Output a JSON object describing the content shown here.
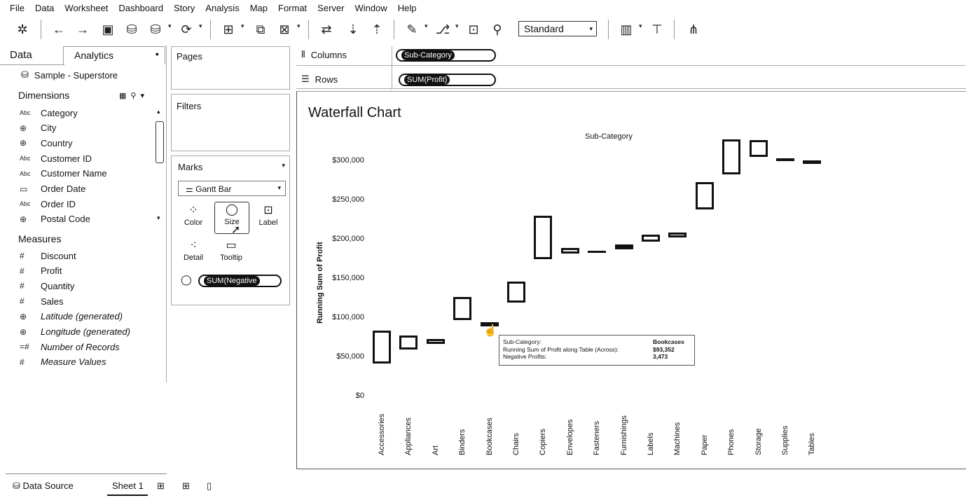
{
  "menu": [
    "File",
    "Data",
    "Worksheet",
    "Dashboard",
    "Story",
    "Analysis",
    "Map",
    "Format",
    "Server",
    "Window",
    "Help"
  ],
  "toolbar": {
    "fit": "Standard",
    "icons": [
      "tableau-logo-icon",
      "undo-icon",
      "redo-icon",
      "save-icon",
      "new-datasource-icon",
      "pause-icon",
      "refresh-icon",
      "new-worksheet-icon",
      "duplicate-icon",
      "clear-sheet-icon",
      "swap-icon",
      "sort-asc-icon",
      "sort-desc-icon",
      "highlight-icon",
      "group-icon",
      "labels-icon",
      "pin-icon",
      "show-cards-icon",
      "presentation-icon",
      "share-icon"
    ]
  },
  "data_pane": {
    "tab_data": "Data",
    "tab_analytics": "Analytics",
    "datasource": "Sample - Superstore",
    "dimensions_header": "Dimensions",
    "measures_header": "Measures",
    "dimensions": [
      {
        "type": "Abc",
        "label": "Category"
      },
      {
        "type": "globe",
        "label": "City"
      },
      {
        "type": "globe",
        "label": "Country"
      },
      {
        "type": "Abc",
        "label": "Customer ID"
      },
      {
        "type": "Abc",
        "label": "Customer Name"
      },
      {
        "type": "date",
        "label": "Order Date"
      },
      {
        "type": "Abc",
        "label": "Order ID"
      },
      {
        "type": "globe",
        "label": "Postal Code"
      }
    ],
    "measures": [
      {
        "type": "#",
        "label": "Discount"
      },
      {
        "type": "#",
        "label": "Profit"
      },
      {
        "type": "#",
        "label": "Quantity"
      },
      {
        "type": "#",
        "label": "Sales"
      },
      {
        "type": "globe",
        "label": "Latitude (generated)",
        "italic": true
      },
      {
        "type": "globe",
        "label": "Longitude (generated)",
        "italic": true
      },
      {
        "type": "=#",
        "label": "Number of Records",
        "italic": true
      },
      {
        "type": "#",
        "label": "Measure Values",
        "italic": true
      }
    ]
  },
  "cards": {
    "pages": "Pages",
    "filters": "Filters",
    "marks": "Marks",
    "mark_type": "Gantt Bar",
    "mark_buttons": [
      "Color",
      "Size",
      "Label",
      "Detail",
      "Tooltip"
    ],
    "size_pill": "SUM(Negative"
  },
  "shelves": {
    "columns_label": "Columns",
    "columns_pill": "Sub-Category",
    "rows_label": "Rows",
    "rows_pill": "SUM(Profit)"
  },
  "view": {
    "title": "Waterfall Chart"
  },
  "chart_data": {
    "type": "bar",
    "title": "Waterfall Chart",
    "xlabel": "Sub-Category",
    "ylabel": "Running Sum of Profit",
    "y_ticks": [
      "$0",
      "$50,000",
      "$100,000",
      "$150,000",
      "$200,000",
      "$250,000",
      "$300,000"
    ],
    "ylim": [
      0,
      300000
    ],
    "categories": [
      "Accessories",
      "Appliances",
      "Art",
      "Binders",
      "Bookcases",
      "Chairs",
      "Copiers",
      "Envelopes",
      "Fasteners",
      "Furnishings",
      "Labels",
      "Machines",
      "Paper",
      "Phones",
      "Storage",
      "Supplies",
      "Tables"
    ],
    "series": [
      {
        "name": "Running Sum of Profit",
        "values": [
          41937,
          60000,
          66700,
          96900,
          93352,
          120000,
          175000,
          182000,
          183500,
          188000,
          197000,
          203000,
          238000,
          283000,
          305000,
          303000,
          300000
        ]
      },
      {
        "name": "Negative Profits",
        "values": [
          -41937,
          -18000,
          -6700,
          -30200,
          3473,
          -26600,
          -55000,
          -7000,
          -1500,
          -4500,
          -9000,
          -6000,
          -35000,
          -45000,
          -22000,
          2000,
          3000
        ]
      }
    ],
    "grid": false,
    "legend": "none"
  },
  "tooltip": {
    "rows": [
      {
        "key": "Sub-Category:",
        "value": "Bookcases"
      },
      {
        "key": "Running Sum of Profit along Table (Across):",
        "value": "$93,352"
      },
      {
        "key": "Negative Profits:",
        "value": "3,473"
      }
    ]
  },
  "bottom": {
    "data_source": "Data Source",
    "sheet": "Sheet 1"
  }
}
